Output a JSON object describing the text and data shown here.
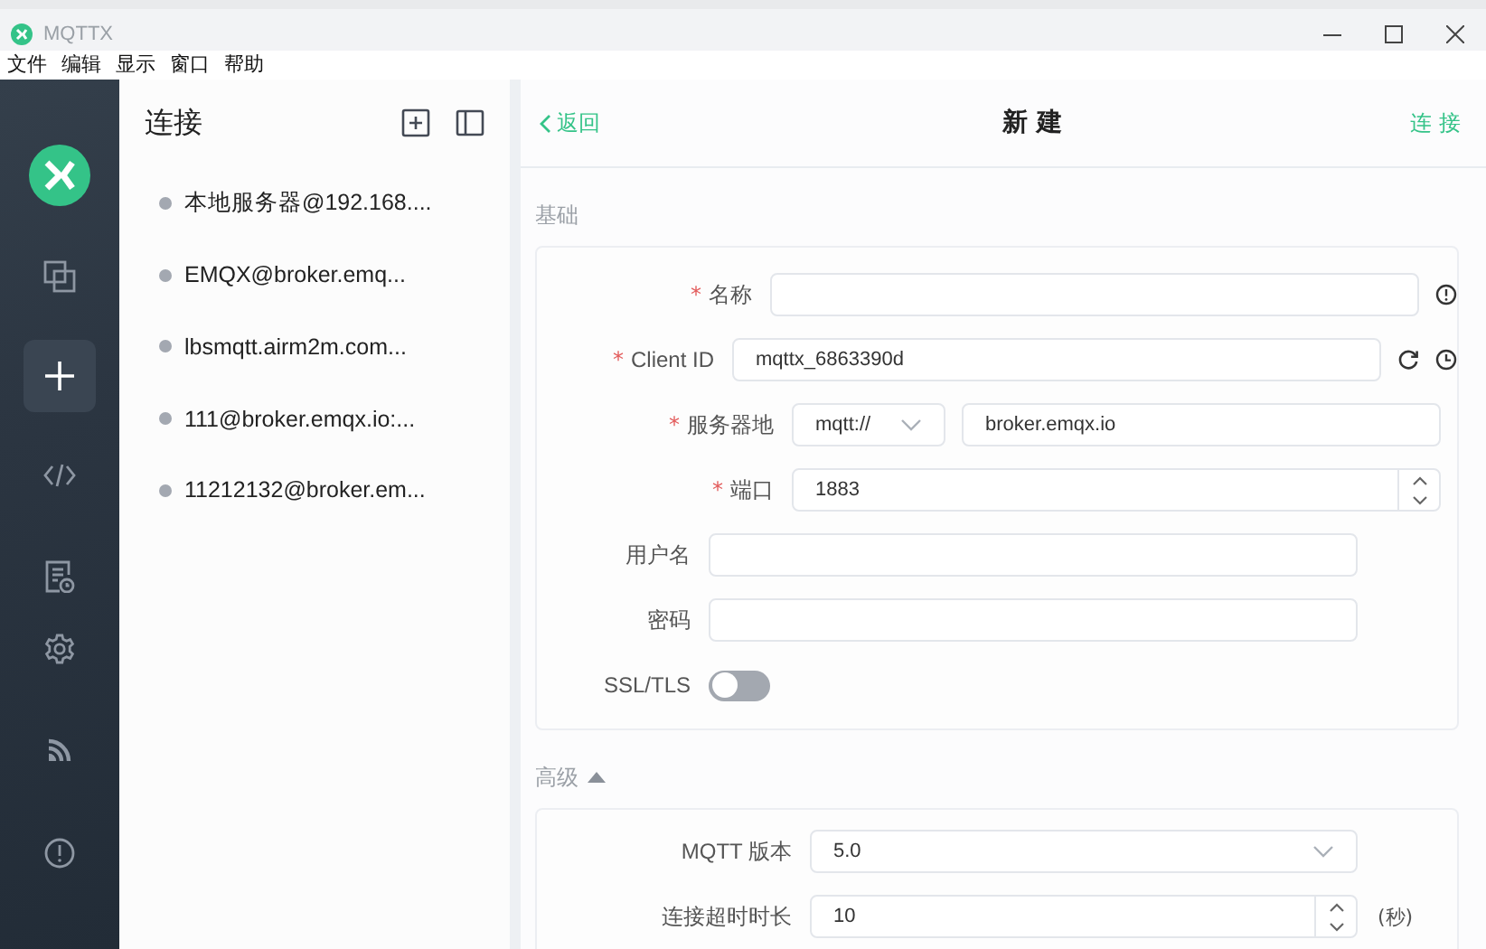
{
  "window": {
    "title": "MQTTX"
  },
  "menu": [
    "文件",
    "编辑",
    "显示",
    "窗口",
    "帮助"
  ],
  "nav": [
    {
      "selected": false
    },
    {
      "selected": false
    },
    {
      "selected": true
    },
    {
      "selected": false
    },
    {
      "selected": false
    },
    {
      "selected": false
    },
    {
      "selected": false
    },
    {
      "selected": false
    }
  ],
  "connections": {
    "title": "连接",
    "items": [
      {
        "name": "本地服务器@192.168....",
        "selected": false
      },
      {
        "name": "EMQX@broker.emq...",
        "selected": false
      },
      {
        "name": "lbsmqtt.airm2m.com...",
        "selected": false
      },
      {
        "name": "111@broker.emqx.io:...",
        "selected": false
      },
      {
        "name": "11212132@broker.em...",
        "selected": false
      }
    ]
  },
  "header": {
    "back": "返回",
    "title": "新 建",
    "action": "连 接"
  },
  "sections": [
    {
      "title": "基础",
      "fields": [
        {
          "kind": "text",
          "marker": "*",
          "label": "名称"
        },
        {
          "kind": "text",
          "marker": "*",
          "label": "Client ID",
          "value": "mqttx_6863390d"
        },
        {
          "kind": "address",
          "marker": "*",
          "label": "服务器地",
          "protocol": "mqtt://",
          "value": "broker.emqx.io"
        },
        {
          "kind": "number",
          "marker": "*",
          "label": "端口",
          "value": "1883"
        },
        {
          "kind": "text",
          "label": "用户名"
        },
        {
          "kind": "text",
          "label": "密码"
        },
        {
          "kind": "switch",
          "label": "SSL/TLS",
          "on": false
        }
      ]
    },
    {
      "title": "高级",
      "expanded": true,
      "fields": [
        {
          "kind": "select",
          "label": "MQTT 版本",
          "value": "5.0"
        },
        {
          "kind": "number",
          "label": "连接超时时长",
          "value": "10",
          "unit": "(秒)"
        }
      ]
    }
  ]
}
